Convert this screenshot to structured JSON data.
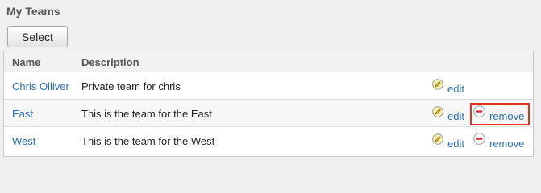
{
  "panel": {
    "title": "My Teams",
    "select_label": "Select"
  },
  "table": {
    "headers": {
      "name": "Name",
      "description": "Description"
    },
    "rows": [
      {
        "name": "Chris Olliver",
        "description": "Private team for chris",
        "edit_label": "edit",
        "remove_label": ""
      },
      {
        "name": "East",
        "description": "This is the team for the East",
        "edit_label": "edit",
        "remove_label": "remove"
      },
      {
        "name": "West",
        "description": "This is the team for the West",
        "edit_label": "edit",
        "remove_label": "remove"
      }
    ]
  },
  "icons": {
    "edit": "pencil-icon",
    "remove": "minus-circle-icon"
  },
  "colors": {
    "link": "#2a6fb6",
    "highlight": "#e0301e"
  }
}
